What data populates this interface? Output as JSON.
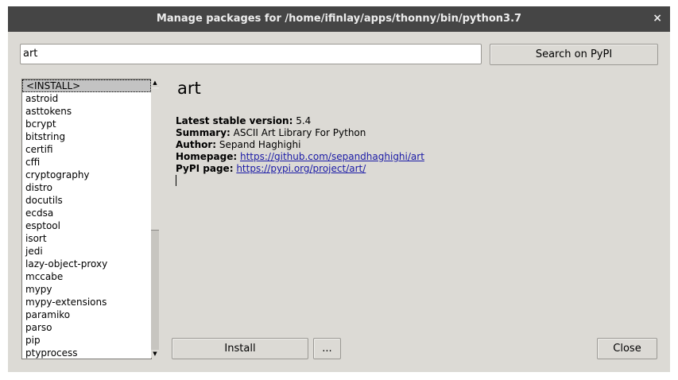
{
  "window": {
    "title": "Manage packages for /home/ifinlay/apps/thonny/bin/python3.7",
    "close_glyph": "×"
  },
  "search": {
    "value": "art",
    "button_label": "Search on PyPI"
  },
  "packages": {
    "items": [
      "<INSTALL>",
      "astroid",
      "asttokens",
      "bcrypt",
      "bitstring",
      "certifi",
      "cffi",
      "cryptography",
      "distro",
      "docutils",
      "ecdsa",
      "esptool",
      "isort",
      "jedi",
      "lazy-object-proxy",
      "mccabe",
      "mypy",
      "mypy-extensions",
      "paramiko",
      "parso",
      "pip",
      "ptyprocess"
    ],
    "selected_index": 0
  },
  "details": {
    "name": "art",
    "version_label": "Latest stable version:",
    "version": "5.4",
    "summary_label": "Summary:",
    "summary": "ASCII Art Library For Python",
    "author_label": "Author:",
    "author": "Sepand Haghighi",
    "homepage_label": "Homepage:",
    "homepage": "https://github.com/sepandhaghighi/art",
    "pypi_label": "PyPI page:",
    "pypi": "https://pypi.org/project/art/"
  },
  "buttons": {
    "install": "Install",
    "more": "...",
    "close": "Close"
  },
  "scrollbar": {
    "up_glyph": "▲",
    "down_glyph": "▼"
  }
}
